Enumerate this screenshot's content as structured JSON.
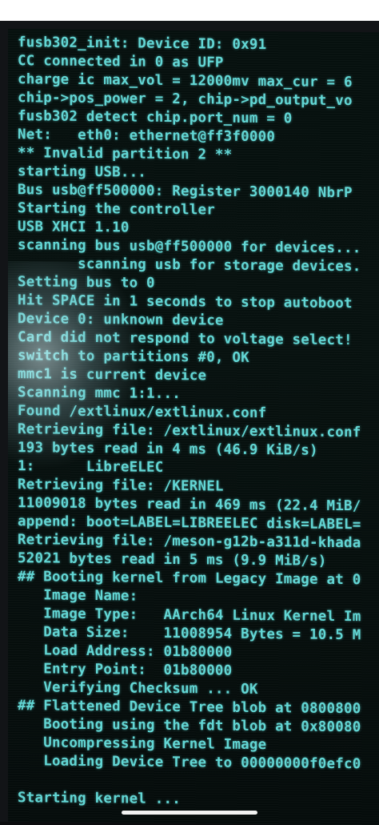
{
  "colors": {
    "terminal_text": "#62d6d4",
    "background": "#07110f"
  },
  "terminal": {
    "lines": [
      "fusb302_init: Device ID: 0x91",
      "CC connected in 0 as UFP",
      "charge ic max_vol = 12000mv max_cur = 6",
      "chip->pos_power = 2, chip->pd_output_vo",
      "fusb302 detect chip.port_num = 0",
      "Net:   eth0: ethernet@ff3f0000",
      "** Invalid partition 2 **",
      "starting USB...",
      "Bus usb@ff500000: Register 3000140 NbrP",
      "Starting the controller",
      "USB XHCI 1.10",
      "scanning bus usb@ff500000 for devices...",
      "       scanning usb for storage devices.",
      "Setting bus to 0",
      "Hit SPACE in 1 seconds to stop autoboot",
      "Device 0: unknown device",
      "Card did not respond to voltage select!",
      "switch to partitions #0, OK",
      "mmc1 is current device",
      "Scanning mmc 1:1...",
      "Found /extlinux/extlinux.conf",
      "Retrieving file: /extlinux/extlinux.conf",
      "193 bytes read in 4 ms (46.9 KiB/s)",
      "1:      LibreELEC",
      "Retrieving file: /KERNEL",
      "11009018 bytes read in 469 ms (22.4 MiB/",
      "append: boot=LABEL=LIBREELEC disk=LABEL=",
      "Retrieving file: /meson-g12b-a311d-khada",
      "52021 bytes read in 5 ms (9.9 MiB/s)",
      "## Booting kernel from Legacy Image at 0",
      "   Image Name:",
      "   Image Type:   AArch64 Linux Kernel Im",
      "   Data Size:    11008954 Bytes = 10.5 M",
      "   Load Address: 01b80000",
      "   Entry Point:  01b80000",
      "   Verifying Checksum ... OK",
      "## Flattened Device Tree blob at 0800800",
      "   Booting using the fdt blob at 0x80080",
      "   Uncompressing Kernel Image",
      "   Loading Device Tree to 00000000f0efc0",
      "",
      "Starting kernel ..."
    ]
  }
}
